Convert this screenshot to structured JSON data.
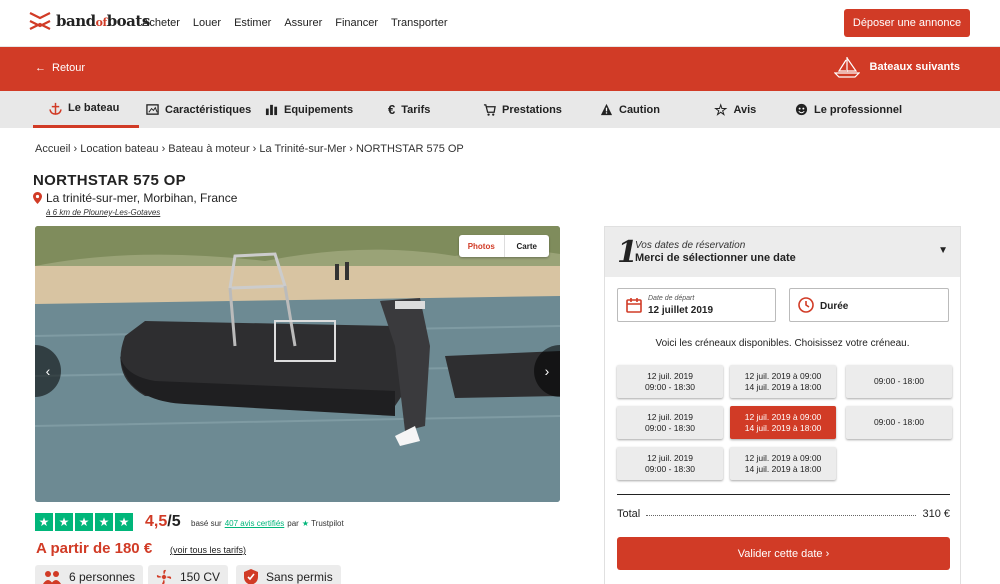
{
  "brand": {
    "logo_text_a": "band",
    "logo_text_b": "of",
    "logo_text_c": "boats",
    "accent": "#d13b26"
  },
  "nav": [
    "Acheter",
    "Louer",
    "Estimer",
    "Assurer",
    "Financer",
    "Transporter"
  ],
  "header_cta": "Déposer une annonce",
  "subbar": {
    "back": "Retour",
    "next": "Bateaux suivants"
  },
  "tabs": [
    {
      "label": "Le bateau",
      "icon": "anchor-icon",
      "active": true
    },
    {
      "label": "Caractéristiques",
      "icon": "image-icon"
    },
    {
      "label": "Equipements",
      "icon": "bars-icon"
    },
    {
      "label": "Tarifs",
      "icon": "euro-icon"
    },
    {
      "label": "Prestations",
      "icon": "cart-icon"
    },
    {
      "label": "Caution",
      "icon": "warning-icon"
    },
    {
      "label": "Avis",
      "icon": "star-icon"
    },
    {
      "label": "Le professionnel",
      "icon": "user-icon"
    }
  ],
  "breadcrumb": "Accueil › Location bateau › Bateau à moteur › La Trinité-sur-Mer › NORTHSTAR 575 OP",
  "boat": {
    "title": "NORTHSTAR 575 OP",
    "location": "La trinité-sur-mer, Morbihan, France",
    "distance": "à 6 km de Plouney-Les-Gotaves",
    "photo_tab": "Photos",
    "map_tab": "Carte"
  },
  "rating": {
    "stars": 5,
    "value": "4,5",
    "max": "/5",
    "based_on": "basé sur",
    "reviews_link": "407 avis certifiés",
    "by": "par",
    "provider": "Trustpilot"
  },
  "price": {
    "text": "A partir de 180 €",
    "link": "(voir tous les tarifs)"
  },
  "features": [
    {
      "icon": "people-icon",
      "label": "6 personnes"
    },
    {
      "icon": "engine-icon",
      "label": "150 CV"
    },
    {
      "icon": "license-icon",
      "label": "Sans permis"
    }
  ],
  "booking": {
    "step": "1",
    "step_small": "Vos dates de réservation",
    "step_big": "Merci de sélectionner une date",
    "start_label": "Date de départ",
    "start_value": "12 juillet 2019",
    "duration_label": "Durée",
    "slots_info": "Voici les créneaux disponibles. Choisissez votre créneau.",
    "slots": [
      {
        "l1": "12 juil. 2019",
        "l2": "09:00 - 18:30",
        "selected": false
      },
      {
        "l1": "12 juil. 2019 à 09:00",
        "l2": "14 juil. 2019 à 18:00",
        "selected": false
      },
      {
        "l1": "09:00 - 18:00",
        "l2": "",
        "selected": false
      },
      {
        "l1": "12 juil. 2019",
        "l2": "09:00 - 18:30",
        "selected": false
      },
      {
        "l1": "12 juil. 2019 à 09:00",
        "l2": "14 juil. 2019 à 18:00",
        "selected": true
      },
      {
        "l1": "09:00 - 18:00",
        "l2": "",
        "selected": false
      },
      {
        "l1": "12 juil. 2019",
        "l2": "09:00 - 18:30",
        "selected": false
      },
      {
        "l1": "12 juil. 2019 à 09:00",
        "l2": "14 juil. 2019 à 18:00",
        "selected": false
      }
    ],
    "total_label": "Total",
    "total_value": "310 €",
    "validate": "Valider cette date ›"
  }
}
